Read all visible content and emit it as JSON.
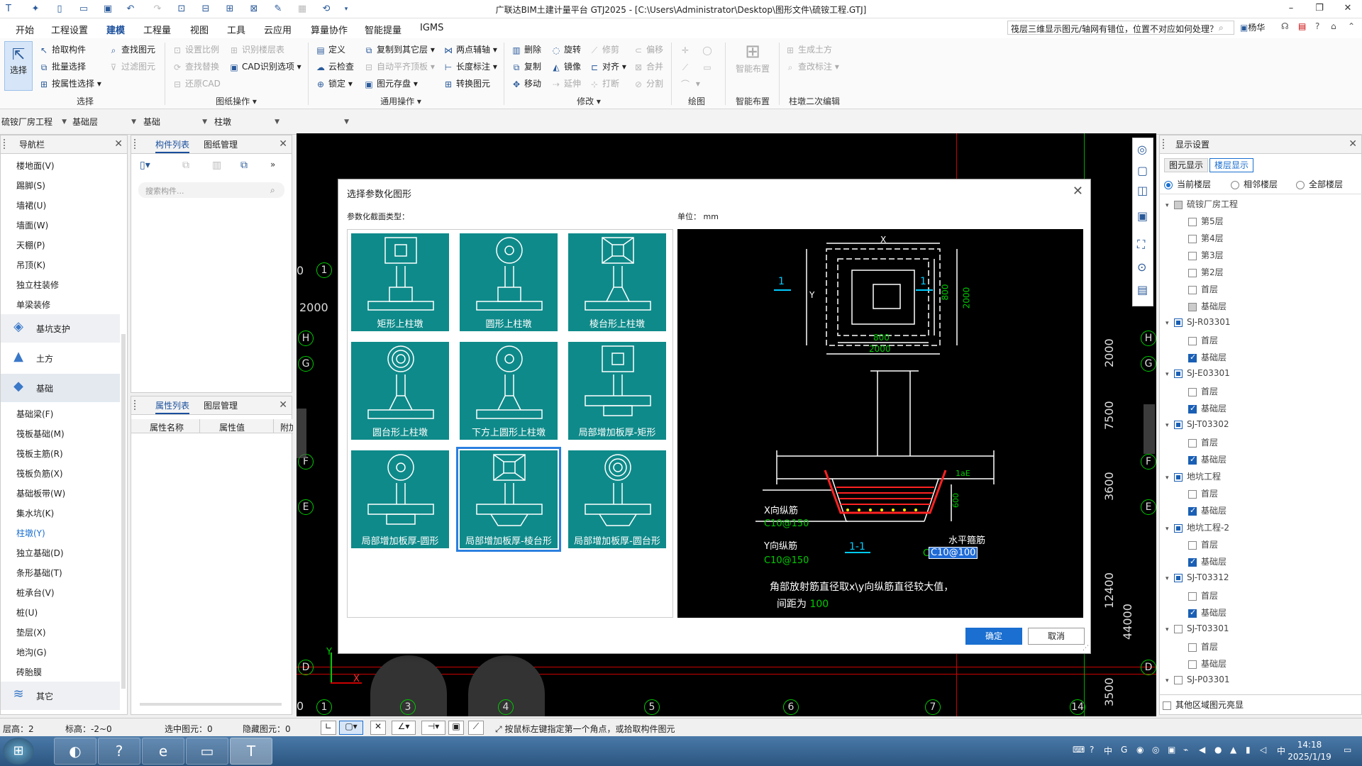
{
  "title": "广联达BIM土建计量平台 GTJ2025 - [C:\\Users\\Administrator\\Desktop\\图形文件\\硫铵工程.GTJ]",
  "menus": [
    "开始",
    "工程设置",
    "建模",
    "工程量",
    "视图",
    "工具",
    "云应用",
    "算量协作",
    "智能提量",
    "IGMS"
  ],
  "help_search": "筏层三维显示图元/轴网有错位，位置不对应如何处理？",
  "user": "杨华",
  "ribbon": {
    "select_label": "选择",
    "pick": "拾取构件",
    "batch": "批量选择",
    "by_attr": "按属性选择",
    "find": "查找图元",
    "filter": "过滤图元",
    "set_scale": "设置比例",
    "find_replace": "查找替换",
    "restore_cad": "还原CAD",
    "recog_floor": "识别楼层表",
    "cad_opt": "CAD识别选项",
    "define": "定义",
    "copy_floor": "复制到其它层",
    "two_point": "两点辅轴",
    "cloud_check": "云检查",
    "auto_flat": "自动平齐顶板",
    "length_mark": "长度标注",
    "lock": "锁定",
    "elem_save": "图元存盘",
    "convert": "转换图元",
    "delete": "删除",
    "rotate": "旋转",
    "trim": "修剪",
    "offset": "偏移",
    "copy": "复制",
    "mirror": "镜像",
    "align": "对齐",
    "merge": "合并",
    "move": "移动",
    "extend": "延伸",
    "break": "打断",
    "split": "分割",
    "smart_layout": "智能布置",
    "gen_earth": "生成土方",
    "change_mark": "查改标注",
    "groups": {
      "select": "选择",
      "drawing": "图纸操作",
      "common": "通用操作",
      "modify": "修改",
      "draw": "绘图",
      "smart": "智能布置",
      "secondary": "柱墩二次编辑"
    }
  },
  "selectors": [
    "硫铵厂房工程",
    "基础层",
    "基础",
    "柱墩"
  ],
  "nav": {
    "title": "导航栏",
    "items_top": [
      "楼地面(V)",
      "踢脚(S)",
      "墙裙(U)",
      "墙面(W)",
      "天棚(P)",
      "吊顶(K)",
      "独立柱装修",
      "单梁装修"
    ],
    "cats": [
      "基坑支护",
      "土方",
      "基础"
    ],
    "items_found": [
      "基础梁(F)",
      "筏板基础(M)",
      "筏板主筋(R)",
      "筏板负筋(X)",
      "基础板带(W)",
      "集水坑(K)",
      "柱墩(Y)",
      "独立基础(D)",
      "条形基础(T)",
      "桩承台(V)",
      "桩(U)",
      "垫层(X)",
      "地沟(G)",
      "砖胎膜"
    ],
    "other": "其它"
  },
  "comp_panel": {
    "tabs": [
      "构件列表",
      "图纸管理"
    ],
    "search_placeholder": "搜索构件..."
  },
  "attr_panel": {
    "tabs": [
      "属性列表",
      "图层管理"
    ],
    "cols": [
      "属性名称",
      "属性值",
      "附加"
    ]
  },
  "canvas": {
    "axis_letters_left": [
      "H",
      "G",
      "F",
      "E",
      "D"
    ],
    "axis_letters_right": [
      "H",
      "G",
      "F",
      "E",
      "D"
    ],
    "axis_numbers": [
      "0",
      "1",
      "3",
      "4",
      "5",
      "6",
      "7",
      "14"
    ],
    "top_numbers": [
      "0",
      "1"
    ],
    "dim_left": "2000",
    "dims_right": [
      "2000",
      "7500",
      "3600",
      "12400",
      "3500"
    ],
    "dim_total": "44000",
    "x_label": "X",
    "y_label": "Y"
  },
  "dialog": {
    "title": "选择参数化图形",
    "type_label": "参数化截面类型：",
    "unit_label": "单位：",
    "unit_value": "mm",
    "shapes": [
      "矩形上柱墩",
      "圆形上柱墩",
      "棱台形上柱墩",
      "圆台形上柱墩",
      "下方上圆形上柱墩",
      "局部增加板厚-矩形",
      "局部增加板厚-圆形",
      "局部增加板厚-棱台形",
      "局部增加板厚-圆台形"
    ],
    "selected_index": 7,
    "preview": {
      "dim_x": "X",
      "dim_y": "Y",
      "dim_800_v": "800",
      "dim_2000_v": "2000",
      "dim_800_h": "800",
      "dim_2000_h": "2000",
      "sec": "1",
      "lae": "1aE",
      "h600": "600",
      "x_bar": "X向纵筋",
      "x_bar_val": "C10@150",
      "y_bar": "Y向纵筋",
      "y_bar_val": "C10@150",
      "hoop": "水平箍筋",
      "hoop_val": "C10@100",
      "c": "C",
      "section": "1-1",
      "note1": "角部放射筋直径取x\\y向纵筋直径较大值，",
      "note2": "间距为",
      "note2_val": "100"
    },
    "ok": "确定",
    "cancel": "取消"
  },
  "display": {
    "title": "显示设置",
    "tabs": [
      "图元显示",
      "楼层显示"
    ],
    "radios": [
      "当前楼层",
      "相邻楼层",
      "全部楼层"
    ],
    "tree": [
      {
        "label": "硫铵厂房工程",
        "level": 0,
        "state": "grey"
      },
      {
        "label": "第5层",
        "level": 1,
        "state": "off"
      },
      {
        "label": "第4层",
        "level": 1,
        "state": "off"
      },
      {
        "label": "第3层",
        "level": 1,
        "state": "off"
      },
      {
        "label": "第2层",
        "level": 1,
        "state": "off"
      },
      {
        "label": "首层",
        "level": 1,
        "state": "off"
      },
      {
        "label": "基础层",
        "level": 1,
        "state": "grey"
      },
      {
        "label": "SJ-R03301",
        "level": 0,
        "state": "part"
      },
      {
        "label": "首层",
        "level": 1,
        "state": "off"
      },
      {
        "label": "基础层",
        "level": 1,
        "state": "on"
      },
      {
        "label": "SJ-E03301",
        "level": 0,
        "state": "part"
      },
      {
        "label": "首层",
        "level": 1,
        "state": "off"
      },
      {
        "label": "基础层",
        "level": 1,
        "state": "on"
      },
      {
        "label": "SJ-T03302",
        "level": 0,
        "state": "part"
      },
      {
        "label": "首层",
        "level": 1,
        "state": "off"
      },
      {
        "label": "基础层",
        "level": 1,
        "state": "on"
      },
      {
        "label": "地坑工程",
        "level": 0,
        "state": "part"
      },
      {
        "label": "首层",
        "level": 1,
        "state": "off"
      },
      {
        "label": "基础层",
        "level": 1,
        "state": "on"
      },
      {
        "label": "地坑工程-2",
        "level": 0,
        "state": "part"
      },
      {
        "label": "首层",
        "level": 1,
        "state": "off"
      },
      {
        "label": "基础层",
        "level": 1,
        "state": "on"
      },
      {
        "label": "SJ-T03312",
        "level": 0,
        "state": "part"
      },
      {
        "label": "首层",
        "level": 1,
        "state": "off"
      },
      {
        "label": "基础层",
        "level": 1,
        "state": "on"
      },
      {
        "label": "SJ-T03301",
        "level": 0,
        "state": "off"
      },
      {
        "label": "首层",
        "level": 1,
        "state": "off"
      },
      {
        "label": "基础层",
        "level": 1,
        "state": "off"
      },
      {
        "label": "SJ-P03301",
        "level": 0,
        "state": "off"
      }
    ],
    "footer": "其他区域图元亮显"
  },
  "status": {
    "floor_h": "层高：2",
    "elev": "标高：-2~0",
    "selected": "选中图元：0",
    "hidden": "隐藏图元：0",
    "hint": "按鼠标左键指定第一个角点，或拾取构件图元"
  },
  "clock": {
    "time": "14:18",
    "date": "2025/1/19"
  }
}
